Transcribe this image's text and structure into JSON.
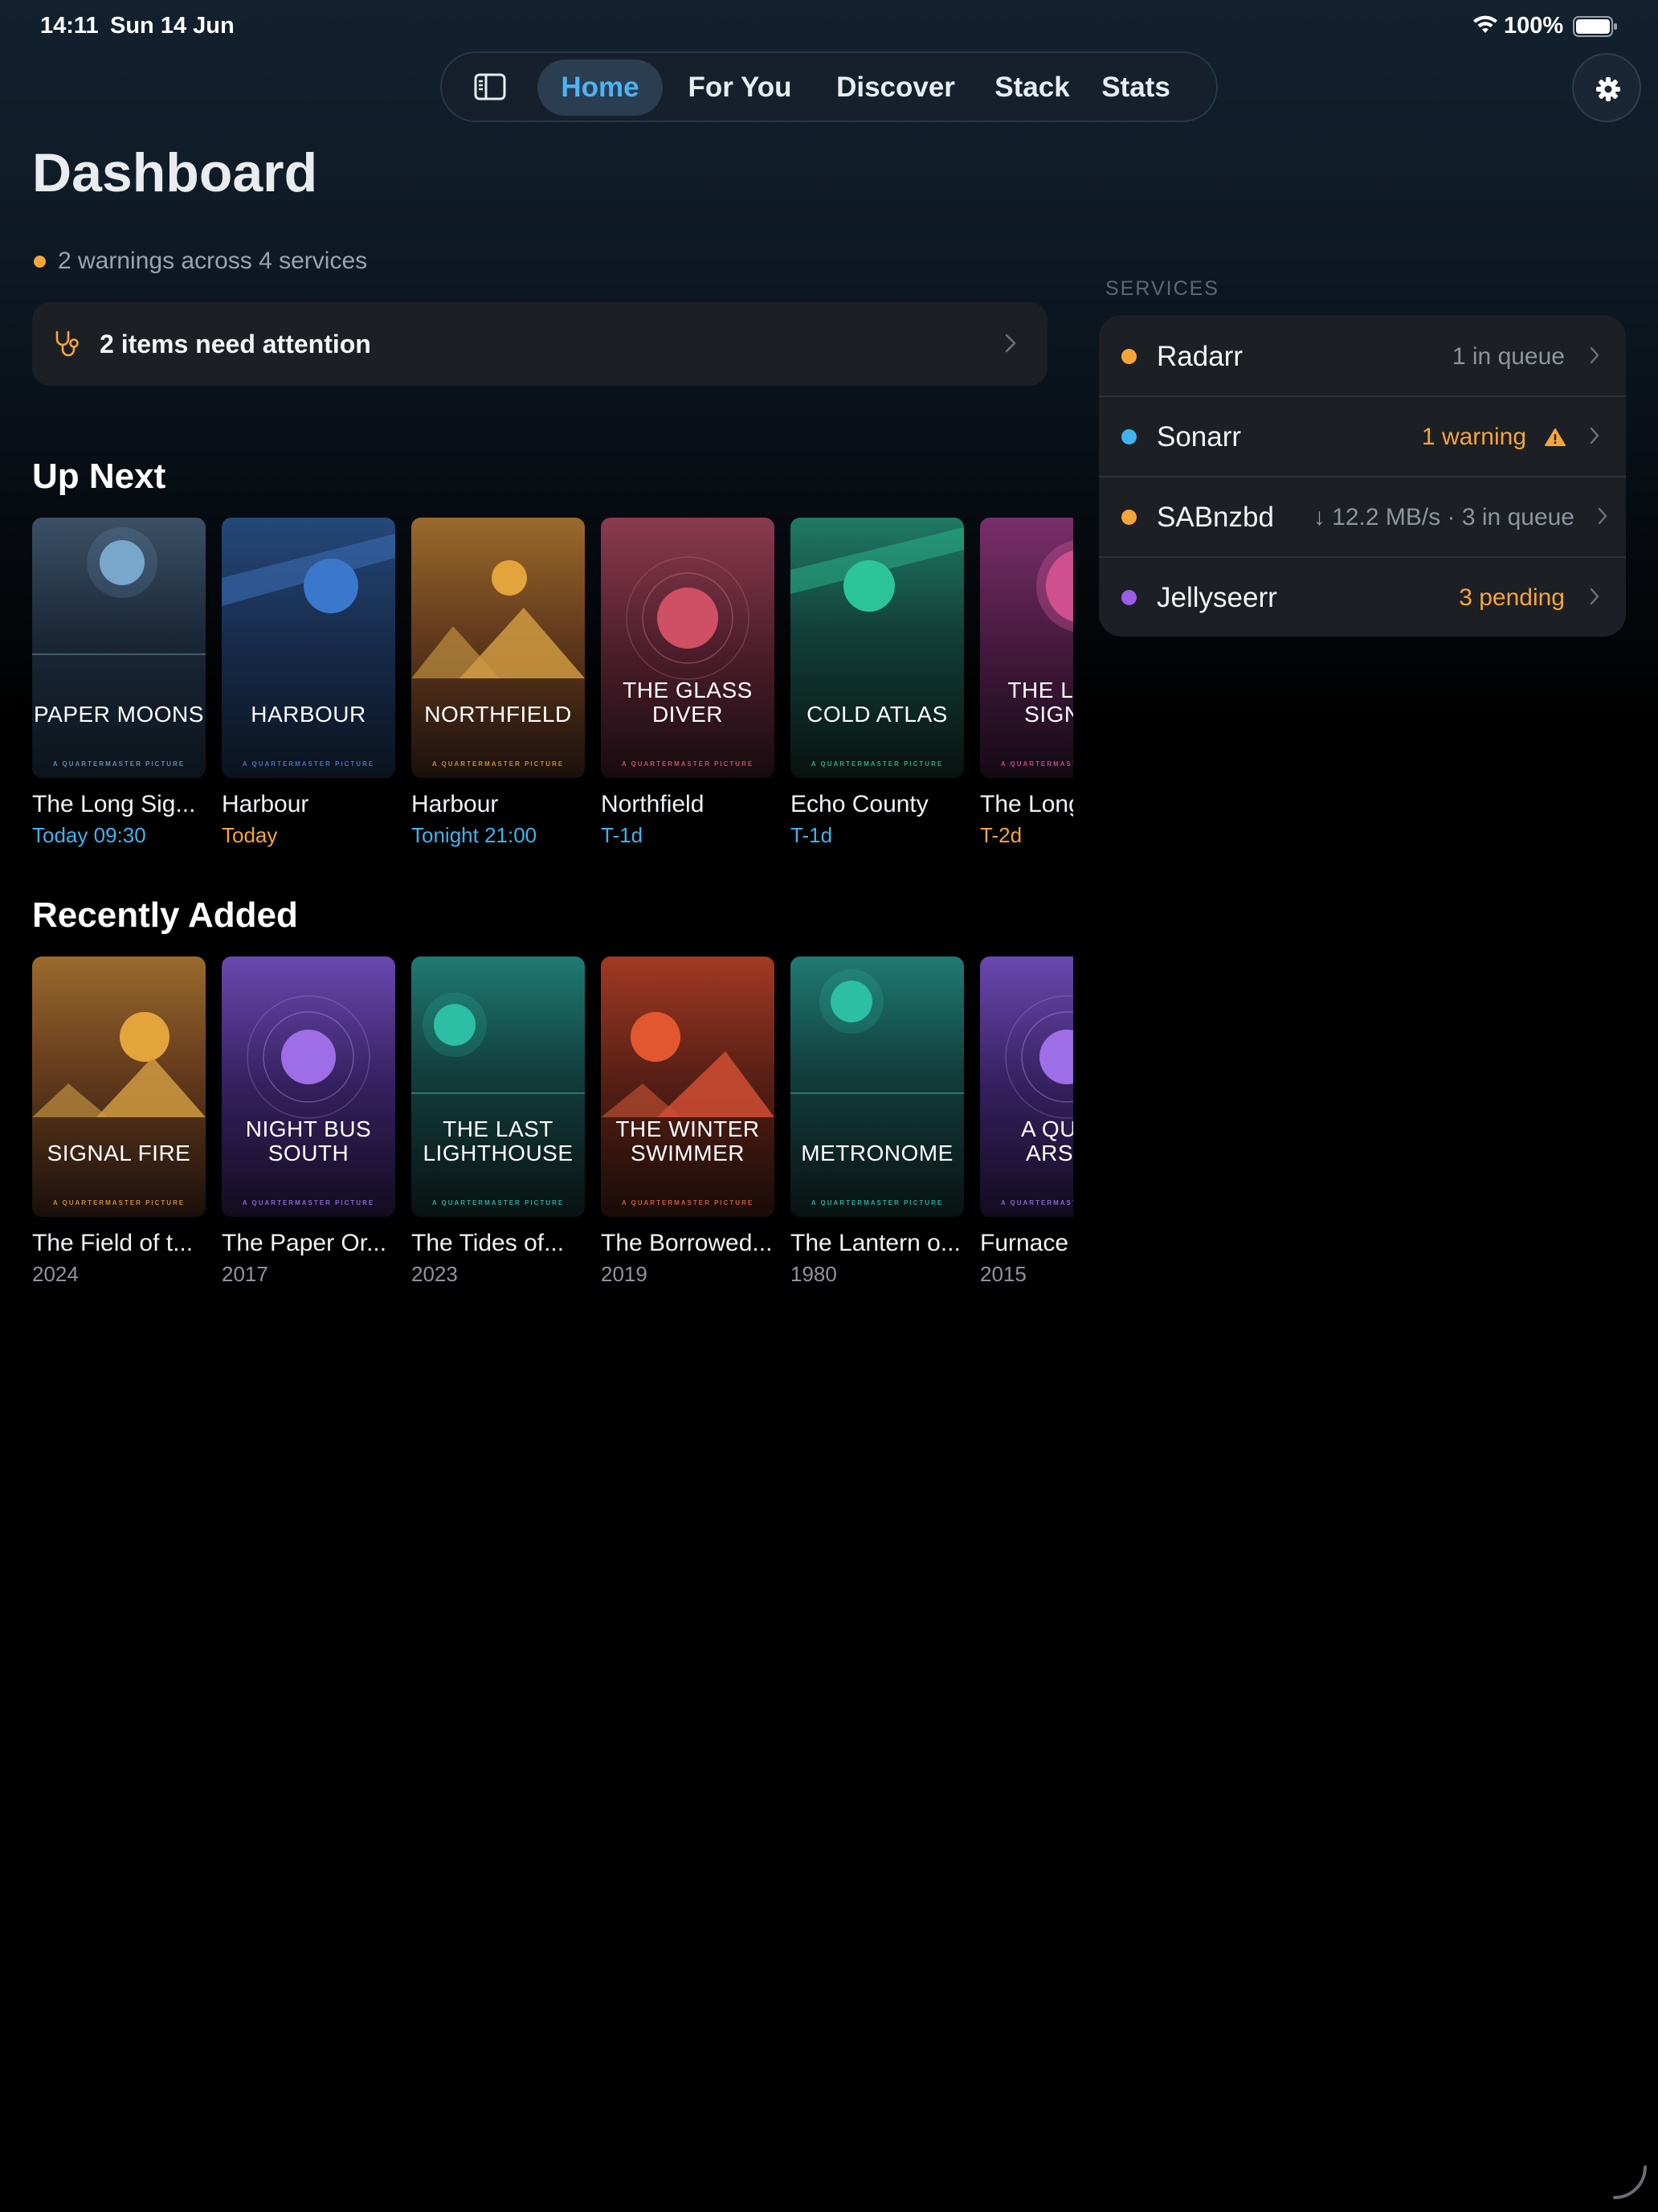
{
  "status_bar": {
    "time": "14:11",
    "date": "Sun 14 Jun",
    "battery": "100%"
  },
  "nav": {
    "tabs": [
      {
        "label": "Home",
        "active": true
      },
      {
        "label": "For You",
        "active": false
      },
      {
        "label": "Discover",
        "active": false
      },
      {
        "label": "Stack",
        "active": false
      },
      {
        "label": "Stats",
        "active": false
      }
    ]
  },
  "page": {
    "title": "Dashboard",
    "warning_summary": "2 warnings across 4 services",
    "attention": "2 items need attention"
  },
  "up_next": {
    "title": "Up Next",
    "items": [
      {
        "poster_title": "PAPER MOONS",
        "studio": "A QUARTERMASTER PICTURE",
        "title": "The Long Sig...",
        "sub": "Today 09:30",
        "sub_color": "#3fb3ef"
      },
      {
        "poster_title": "HARBOUR",
        "studio": "A QUARTERMASTER PICTURE",
        "title": "Harbour",
        "sub": "Today",
        "sub_color": "#f5a53c"
      },
      {
        "poster_title": "NORTHFIELD",
        "studio": "A QUARTERMASTER PICTURE",
        "title": "Harbour",
        "sub": "Tonight 21:00",
        "sub_color": "#3fb3ef"
      },
      {
        "poster_title": "THE GLASS DIVER",
        "studio": "A QUARTERMASTER PICTURE",
        "title": "Northfield",
        "sub": "T-1d",
        "sub_color": "#3fb3ef"
      },
      {
        "poster_title": "COLD ATLAS",
        "studio": "A QUARTERMASTER PICTURE",
        "title": "Echo County",
        "sub": "T-1d",
        "sub_color": "#3fb3ef"
      },
      {
        "poster_title": "THE LONG SIGNAL",
        "studio": "A QUARTERMASTER PICTURE",
        "title": "The Long Signal",
        "sub": "T-2d",
        "sub_color": "#f5a53c"
      }
    ]
  },
  "recently_added": {
    "title": "Recently Added",
    "items": [
      {
        "poster_title": "SIGNAL FIRE",
        "studio": "A QUARTERMASTER PICTURE",
        "title": "The Field of t...",
        "sub": "2024"
      },
      {
        "poster_title": "NIGHT BUS SOUTH",
        "studio": "A QUARTERMASTER PICTURE",
        "title": "The Paper Or...",
        "sub": "2017"
      },
      {
        "poster_title": "THE LAST LIGHTHOUSE",
        "studio": "A QUARTERMASTER PICTURE",
        "title": "The Tides of...",
        "sub": "2023"
      },
      {
        "poster_title": "THE WINTER SWIMMER",
        "studio": "A QUARTERMASTER PICTURE",
        "title": "The Borrowed...",
        "sub": "2019"
      },
      {
        "poster_title": "METRONOME",
        "studio": "A QUARTERMASTER PICTURE",
        "title": "The Lantern o...",
        "sub": "1980"
      },
      {
        "poster_title": "A QUIET ARSON",
        "studio": "A QUARTERMASTER PICTURE",
        "title": "Furnace",
        "sub": "2015"
      }
    ]
  },
  "services": {
    "label": "SERVICES",
    "items": [
      {
        "name": "Radarr",
        "status": "1 in queue",
        "dot": "#f6a53a",
        "status_color": "#8d959e",
        "warning_icon": false
      },
      {
        "name": "Sonarr",
        "status": "1 warning",
        "dot": "#3fb3ef",
        "status_color": "#f5a53c",
        "warning_icon": true
      },
      {
        "name": "SABnzbd",
        "status": "↓ 12.2 MB/s · 3 in queue",
        "dot": "#f6a53a",
        "status_color": "#8d959e",
        "warning_icon": false
      },
      {
        "name": "Jellyseerr",
        "status": "3 pending",
        "dot": "#9b5de5",
        "status_color": "#f5a53c",
        "warning_icon": false
      }
    ]
  },
  "colors": {
    "accent": "#4db4f5",
    "warning": "#f5a53c",
    "background": "#000000",
    "card": "#1c1f24"
  }
}
